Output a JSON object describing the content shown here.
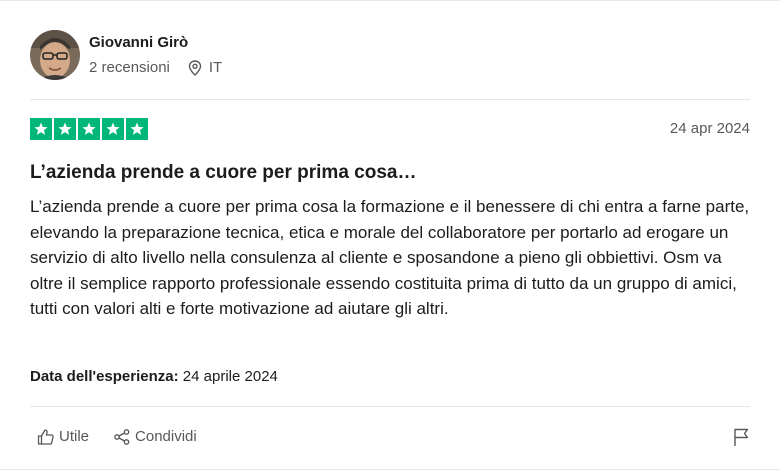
{
  "reviewer": {
    "name": "Giovanni Girò",
    "reviews_count": "2 recensioni",
    "country": "IT"
  },
  "review": {
    "rating": 5,
    "rating_max": 5,
    "date": "24 apr 2024",
    "title": "L’azienda prende a cuore per prima cosa…",
    "body": "L’azienda prende a cuore per prima cosa la formazione e il benessere di chi entra a farne parte, elevando la preparazione tecnica, etica e morale del collaboratore per portarlo ad erogare un servizio di alto livello nella consulenza al cliente e sposandone a pieno gli obbiettivi. Osm va oltre il semplice rapporto professionale essendo costituita prima di tutto da un gruppo di amici, tutti con valori alti e forte motivazione ad aiutare gli altri.",
    "experience_label": "Data dell'esperienza:",
    "experience_date": "24 aprile 2024",
    "star_color": "#00b67a"
  },
  "actions": {
    "useful_label": "Utile",
    "share_label": "Condividi"
  },
  "icons": {
    "location": "location-pin-icon",
    "useful": "thumbs-up-icon",
    "share": "share-icon",
    "report": "flag-icon"
  }
}
